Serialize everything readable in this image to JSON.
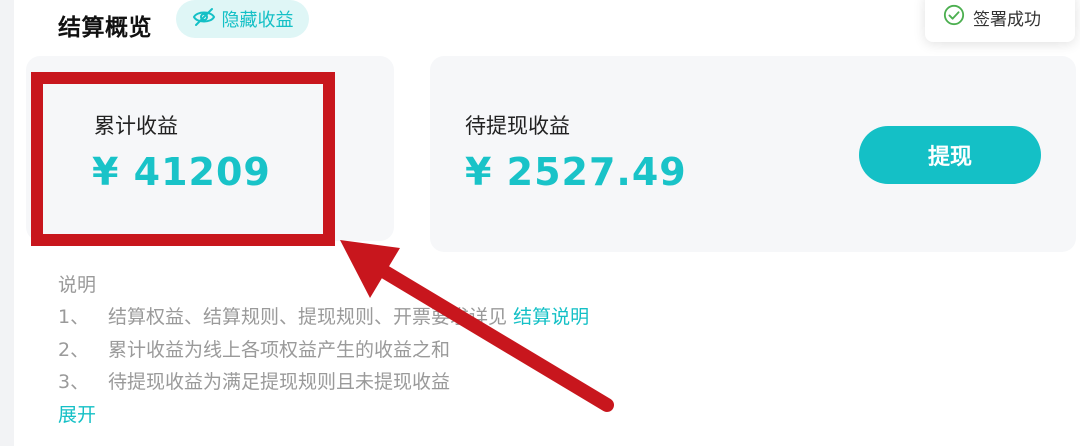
{
  "header": {
    "title": "结算概览",
    "hide_earnings_label": "隐藏收益"
  },
  "toast": {
    "message": "签署成功"
  },
  "summary": {
    "total": {
      "label": "累计收益",
      "value": "¥ 41209"
    },
    "pending": {
      "label": "待提现收益",
      "value": "¥ 2527.49"
    },
    "withdraw_button": "提现"
  },
  "notes": {
    "title": "说明",
    "items": [
      {
        "num": "1、",
        "text": "结算权益、结算规则、提现规则、开票要求详见",
        "link": "结算说明"
      },
      {
        "num": "2、",
        "text": "累计收益为线上各项权益产生的收益之和"
      },
      {
        "num": "3、",
        "text": "待提现收益为满足提现规则且未提现收益"
      }
    ],
    "expand": "展开"
  },
  "colors": {
    "accent": "#14c0c6",
    "annotation_red": "#c8161d",
    "success_green": "#4caf50"
  },
  "icons": [
    "eye-off-icon",
    "check-circle-icon",
    "annotation-arrow"
  ]
}
